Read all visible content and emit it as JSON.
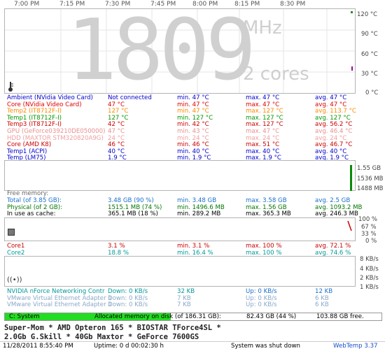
{
  "times": [
    "7:00 PM",
    "7:15 PM",
    "7:30 PM",
    "7:45 PM",
    "8:00 PM",
    "8:15 PM",
    "8:30 PM"
  ],
  "cpu": {
    "big_digits": "1809",
    "unit": "MHz",
    "cores_label": "2 cores"
  },
  "temp_axis": [
    "120 °C",
    "90 °C",
    "60 °C",
    "30 °C",
    "0 °C"
  ],
  "sensors": [
    {
      "name": "Ambient (NVidia Video Card)",
      "cur": "Not connected",
      "min": "min. 47 °C",
      "max": "max. 47 °C",
      "avg": "avg. 47 °C",
      "color": "#0000cc"
    },
    {
      "name": "Core (NVidia Video Card)",
      "cur": "47 °C",
      "min": "min. 47 °C",
      "max": "max. 47 °C",
      "avg": "avg. 47 °C",
      "color": "#dd0000"
    },
    {
      "name": "Temp2 (IT8712F-I)",
      "cur": "127 °C",
      "min": "min. 47 °C",
      "max": "max. 127 °C",
      "avg": "avg. 113.7 °C",
      "color": "#ff8800"
    },
    {
      "name": "Temp1 (IT8712F-I)",
      "cur": "127 °C",
      "min": "min. 127 °C",
      "max": "max. 127 °C",
      "avg": "avg. 127 °C",
      "color": "#009900"
    },
    {
      "name": "Temp3 (IT8712F-I)",
      "cur": "42 °C",
      "min": "min. 42 °C",
      "max": "max. 127 °C",
      "avg": "avg. 56.2 °C",
      "color": "#cc0000"
    },
    {
      "name": "GPU (GeForce039210DE050000)",
      "cur": "47 °C",
      "min": "min. 43 °C",
      "max": "max. 47 °C",
      "avg": "avg. 46.4 °C",
      "color": "#e89090"
    },
    {
      "name": "HDD (MAXTOR STM320820A9G)",
      "cur": "24 °C",
      "min": "min. 24 °C",
      "max": "max. 24 °C",
      "avg": "avg. 24 °C",
      "color": "#f0a0a0"
    },
    {
      "name": "Core (AMD K8)",
      "cur": "46 °C",
      "min": "min. 46 °C",
      "max": "max. 51 °C",
      "avg": "avg. 46.7 °C",
      "color": "#cc0000"
    },
    {
      "name": "Temp1 (ACPI)",
      "cur": "40 °C",
      "min": "min. 40 °C",
      "max": "max. 40 °C",
      "avg": "avg. 40 °C",
      "color": "#0000cc"
    },
    {
      "name": "Temp (LM75)",
      "cur": "1.9 °C",
      "min": "min. 1.9 °C",
      "max": "max. 1.9 °C",
      "avg": "avg. 1.9 °C",
      "color": "#0000cc"
    }
  ],
  "mem_axis": [
    "1.55 GB",
    "1536 MB",
    "1488 MB"
  ],
  "memory_title": "Free memory:",
  "memory": [
    {
      "name": "Total (of 3.85 GB):",
      "cur": "3.48 GB (90 %)",
      "min": "min. 3.48 GB",
      "max": "max. 3.58 GB",
      "avg": "avg. 2.5 GB",
      "color": "#1a6fcc"
    },
    {
      "name": "Physical (of 2 GB):",
      "cur": "1515.1 MB (74 %)",
      "min": "min. 1496.6 MB",
      "max": "max. 1.56 GB",
      "avg": "avg. 1093.2 MB",
      "color": "#007700"
    },
    {
      "name": "In use as cache:",
      "cur": "365.1 MB (18 %)",
      "min": "min. 289.2 MB",
      "max": "max. 365.3 MB",
      "avg": "avg. 246.3 MB",
      "color": "#000000"
    }
  ],
  "load_axis": [
    "100 %",
    "67 %",
    "33 %",
    "0 %"
  ],
  "cores": [
    {
      "name": "Core1",
      "cur": "3.1 %",
      "min": "min. 3.1 %",
      "max": "max. 100 %",
      "avg": "avg. 72.1 %",
      "color": "#cc0000"
    },
    {
      "name": "Core2",
      "cur": "18.8 %",
      "min": "min. 16.4 %",
      "max": "max. 100 %",
      "avg": "avg. 74.6 %",
      "color": "#009999"
    }
  ],
  "net_axis": [
    "8 KB/s",
    "4 KB/s",
    "2 KB/s",
    "1 KB/s"
  ],
  "network": [
    {
      "name": "NVIDIA nForce Networking Contr",
      "down": "Down: 0 KB/s",
      "total_down": "32 KB",
      "up": "Up: 0 KB/s",
      "total_up": "12 KB",
      "color": "#009999",
      "upcolor": "#1a6fcc"
    },
    {
      "name": "VMware Virtual Ethernet Adapter 1",
      "down": "Down: 0 KB/s",
      "total_down": "7 KB",
      "up": "Up: 0 KB/s",
      "total_up": "6 KB",
      "color": "#8aa8c8",
      "upcolor": "#8aa8c8"
    },
    {
      "name": "VMware Virtual Ethernet Adapter 1",
      "down": "Down: 0 KB/s",
      "total_down": "7 KB",
      "up": "Up: 0 KB/s",
      "total_up": "6 KB",
      "color": "#8aa8c8",
      "upcolor": "#8aa8c8"
    }
  ],
  "disk": {
    "label": "C: System",
    "alloc": "Allocated memory on disk (of 186.31 GB):",
    "used": "82.43 GB (44 %)",
    "free": "103.88 GB free.",
    "percent": 44
  },
  "system_line1": "Super-Mom * AMD Opteron 165 * BIOSTAR TForce4SL *",
  "system_line2": "2.0Gb G.Skill * 40Gb Maxtor * GeForce 7600GS",
  "status": {
    "datetime": "11/28/2011 8:55:40 PM",
    "uptime": "Uptime: 0 d 00:02:30 h",
    "shutdown": "System was shut down",
    "app": "WebTemp 3.37"
  }
}
